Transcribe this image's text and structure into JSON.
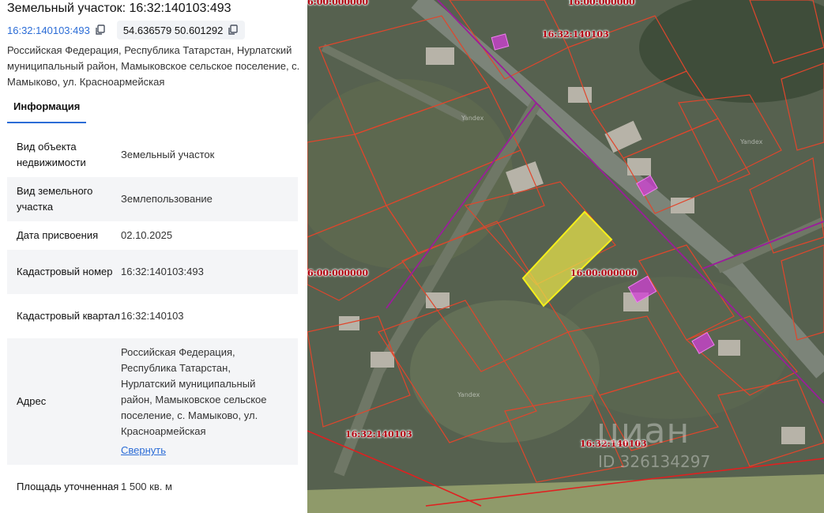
{
  "header": {
    "title": "Земельный участок: 16:32:140103:493",
    "cadastral_link": "16:32:140103:493",
    "coordinates": "54.636579 50.601292",
    "address_short": "Российская Федерация, Республика Татарстан, Нурлатский муниципальный район, Мамыковское сельское поселение, с. Мамыково, ул. Красноармейская"
  },
  "tabs": [
    {
      "label": "Информация"
    }
  ],
  "info": {
    "rows": [
      {
        "label": "Вид объекта недвижимости",
        "value": "Земельный участок"
      },
      {
        "label": "Вид земельного участка",
        "value": "Землепользование"
      },
      {
        "label": "Дата присвоения",
        "value": "02.10.2025"
      },
      {
        "label": "Кадастровый номер",
        "value": "16:32:140103:493"
      },
      {
        "label": "Кадастровый квартал",
        "value": "16:32:140103"
      },
      {
        "label": "Адрес",
        "value": "Российская Федерация, Республика Татарстан, Нурлатский муниципальный район, Мамыковское сельское поселение, с. Мамыково, ул. Красноармейская"
      },
      {
        "label": "Площадь уточненная",
        "value": "1 500 кв. м"
      }
    ],
    "collapse_label": "Свернуть"
  },
  "map": {
    "labels": {
      "zone_top_left": "6:00:000000",
      "zone_top": "16:00:000000",
      "block_top": "16:32:140103",
      "zone_left": "6:00:000000",
      "zone_center": "16:00:000000",
      "block_bottom_left": "16:32:140103",
      "block_bottom_right": "16:32:140103"
    },
    "watermark": "циан",
    "watermark_id": "ID 326134297",
    "yandex": "Yandex",
    "colors": {
      "parcel_border": "#e0462c",
      "quarter_border": "#9b1d9b",
      "zone_border": "#e02020",
      "selected_fill": "#e6e04a",
      "selected_border": "#f5ef1a",
      "building": "#d23fd6"
    }
  }
}
